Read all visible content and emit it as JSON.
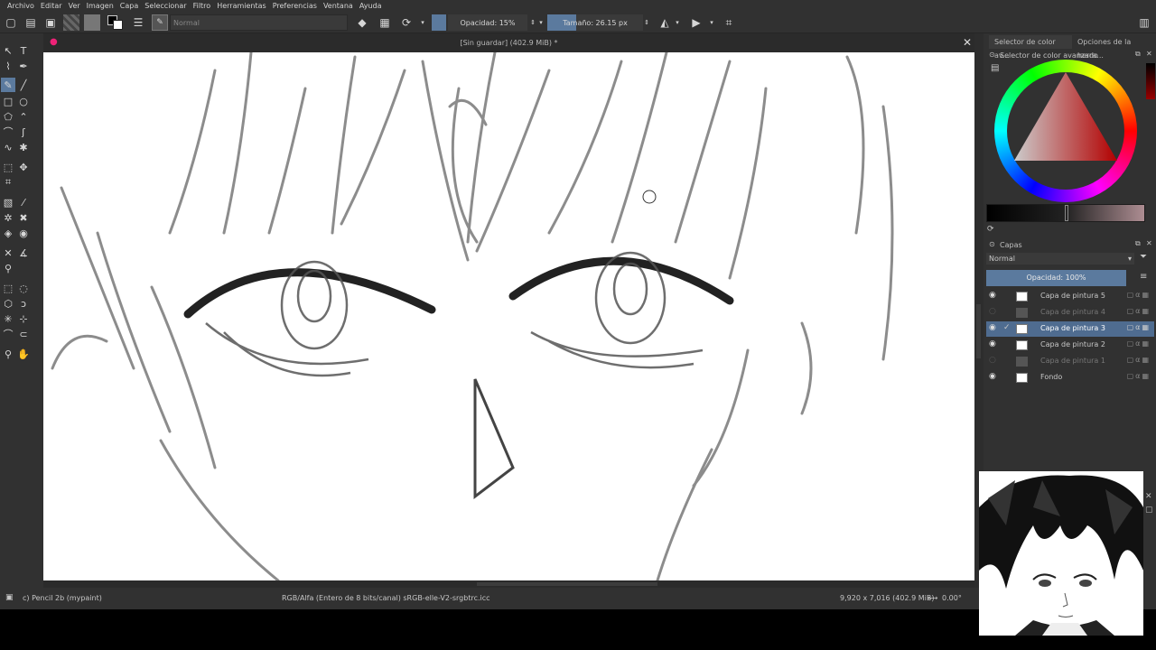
{
  "menu": [
    "Archivo",
    "Editar",
    "Ver",
    "Imagen",
    "Capa",
    "Seleccionar",
    "Filtro",
    "Herramientas",
    "Preferencias",
    "Ventana",
    "Ayuda"
  ],
  "toolbar": {
    "blend_mode": "Normal",
    "opacity_label": "Opacidad: 15%",
    "size_label": "Tamaño: 26.15 px"
  },
  "document": {
    "title": "[Sin guardar]  (402.9 MiB) *"
  },
  "dock": {
    "tab_color_selector": "Selector de color av...",
    "tab_tool_options": "Opciones de la herra...",
    "color_selector_title": "Selector de color avanzado",
    "layers_title": "Capas",
    "layers_blend_mode": "Normal",
    "layers_opacity": "Opacidad:  100%",
    "layers": [
      {
        "name": "Capa de pintura 5",
        "visible": true
      },
      {
        "name": "Capa de pintura 4",
        "visible": false
      },
      {
        "name": "Capa de pintura 3",
        "visible": true,
        "selected": true
      },
      {
        "name": "Capa de pintura 2",
        "visible": true
      },
      {
        "name": "Capa de pintura 1",
        "visible": false
      },
      {
        "name": "Fondo",
        "visible": true
      }
    ]
  },
  "status": {
    "brush": "c) Pencil 2b (mypaint)",
    "color_profile": "RGB/Alfa (Entero de 8 bits/canal)  sRGB-elle-V2-srgbtrc.icc",
    "dimensions": "9,920 x 7,016 (402.9 MiB)",
    "rotation": "0.00°"
  },
  "colors": {
    "accent": "#5b7a9e",
    "panel_bg": "#313131",
    "selected_layer": "#4f6c90"
  }
}
